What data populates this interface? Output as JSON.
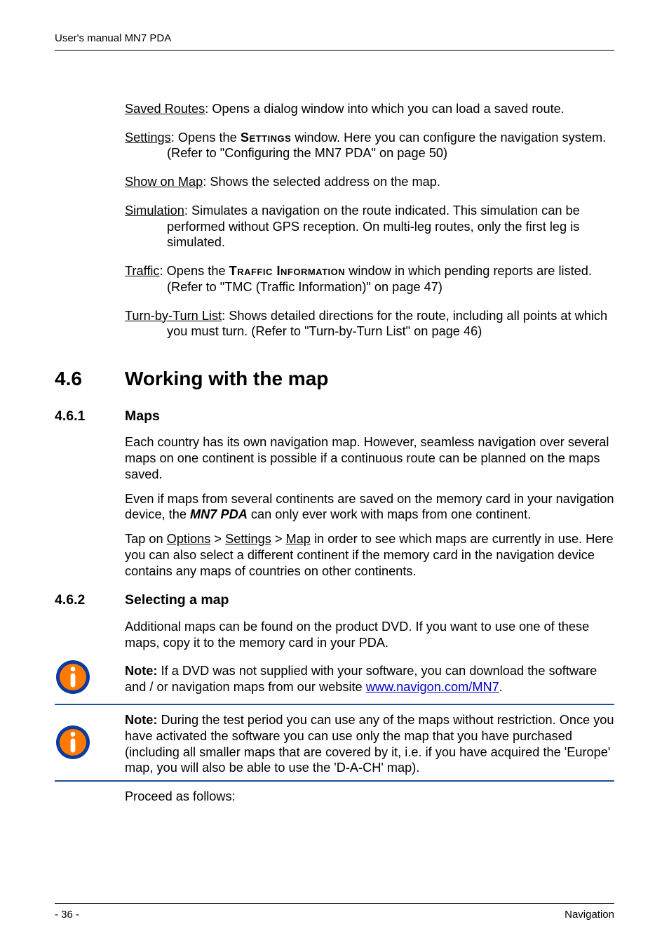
{
  "header": "User's manual MN7 PDA",
  "defs": {
    "savedRoutes": {
      "term": "Saved Routes",
      "body": ": Opens a dialog window into which you can load a saved route."
    },
    "settings": {
      "term": "Settings",
      "prefix": ": Opens the ",
      "sc": "Settings",
      "suffix": " window. Here you can configure the navigation system. (Refer to \"Configuring the MN7 PDA\" on page 50)"
    },
    "showOnMap": {
      "term": "Show on Map",
      "body": ": Shows the selected address on the map."
    },
    "simulation": {
      "term": "Simulation",
      "body": ": Simulates a navigation on the route indicated. This simulation can be performed without GPS reception. On multi-leg routes, only the first leg is simulated."
    },
    "traffic": {
      "term": "Traffic",
      "prefix": ":  Opens the ",
      "sc": "Traffic Information",
      "suffix": " window in which pending reports are listed. (Refer to \"TMC (Traffic Information)\" on page 47)"
    },
    "turnByTurn": {
      "term": "Turn-by-Turn List",
      "body": ": Shows detailed directions for the route, including all points at which you must turn. (Refer to \"Turn-by-Turn List\" on page 46)"
    }
  },
  "h1": {
    "num": "4.6",
    "text": "Working with the map"
  },
  "s461": {
    "num": "4.6.1",
    "title": "Maps",
    "p1": "Each country has its own navigation map. However, seamless navigation over several maps on one continent is possible if a continuous route can be planned on the maps saved.",
    "p2a": "Even if maps from several continents are saved on the memory card in your navigation device, the ",
    "p2b": "MN7 PDA",
    "p2c": " can only ever work with maps from one continent.",
    "p3a": "Tap on ",
    "p3opt": "Options",
    "p3gt1": " > ",
    "p3set": "Settings",
    "p3gt2": " > ",
    "p3map": "Map",
    "p3b": " in order to see which maps are currently in use. Here you can also select a different continent if the memory card in the navigation device contains any maps of countries on other continents."
  },
  "s462": {
    "num": "4.6.2",
    "title": "Selecting a map",
    "p1": "Additional maps can be found on the product DVD. If you want to use one of these maps, copy it to the memory card in your PDA.",
    "note1a": "Note:",
    "note1b": " If a DVD was not supplied with your software, you can download the software and / or navigation maps from our website ",
    "note1link": "www.navigon.com/MN7",
    "note1c": ".",
    "note2a": "Note:",
    "note2b": " During the test period you can use any of the maps without restriction. Once you have activated the software you can use only  the map that you have purchased (including all smaller maps that are covered by it, i.e. if you have acquired the 'Europe' map, you will also be able to use the 'D-A-CH' map).",
    "p2": "Proceed as follows:"
  },
  "footer": {
    "left": "- 36 -",
    "right": "Navigation"
  }
}
